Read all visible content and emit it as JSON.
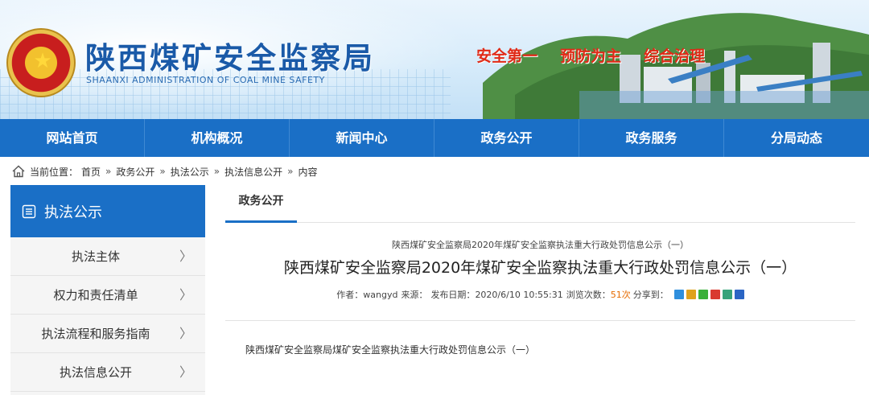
{
  "header": {
    "title_cn": "陕西煤矿安全监察局",
    "title_en": "SHAANXI ADMINISTRATION OF COAL MINE SAFETY",
    "slogans": [
      "安全第一",
      "预防为主",
      "综合治理"
    ],
    "colors": {
      "brand_blue": "#1a5aa8",
      "slogan_red": "#e02a17",
      "nav_blue": "#1a6fc6"
    }
  },
  "nav": {
    "items": [
      {
        "label": "网站首页"
      },
      {
        "label": "机构概况"
      },
      {
        "label": "新闻中心"
      },
      {
        "label": "政务公开"
      },
      {
        "label": "政务服务"
      },
      {
        "label": "分局动态"
      }
    ]
  },
  "breadcrumb": {
    "prefix": "当前位置：",
    "items": [
      "首页",
      "政务公开",
      "执法公示",
      "执法信息公开",
      "内容"
    ],
    "separator": "»"
  },
  "sidebar": {
    "title": "执法公示",
    "items": [
      {
        "label": "执法主体"
      },
      {
        "label": "权力和责任清单"
      },
      {
        "label": "执法流程和服务指南"
      },
      {
        "label": "执法信息公开"
      }
    ]
  },
  "article": {
    "tab": "政务公开",
    "small_title": "陕西煤矿安全监察局2020年煤矿安全监察执法重大行政处罚信息公示（一）",
    "title": "陕西煤矿安全监察局2020年煤矿安全监察执法重大行政处罚信息公示（一）",
    "meta": {
      "author_label": "作者：",
      "author": "wangyd",
      "source_label": "来源：",
      "date_label": "发布日期：",
      "date": "2020/6/10 10:55:31",
      "views_label": "浏览次数：",
      "views": "51次",
      "share_label": "分享到："
    },
    "share_icons": [
      "qzone-icon",
      "weibo-icon",
      "wechat-icon",
      "tencent-weibo-icon",
      "douban-icon",
      "renren-icon"
    ],
    "body": "陕西煤矿安全监察局煤矿安全监察执法重大行政处罚信息公示（一）"
  }
}
